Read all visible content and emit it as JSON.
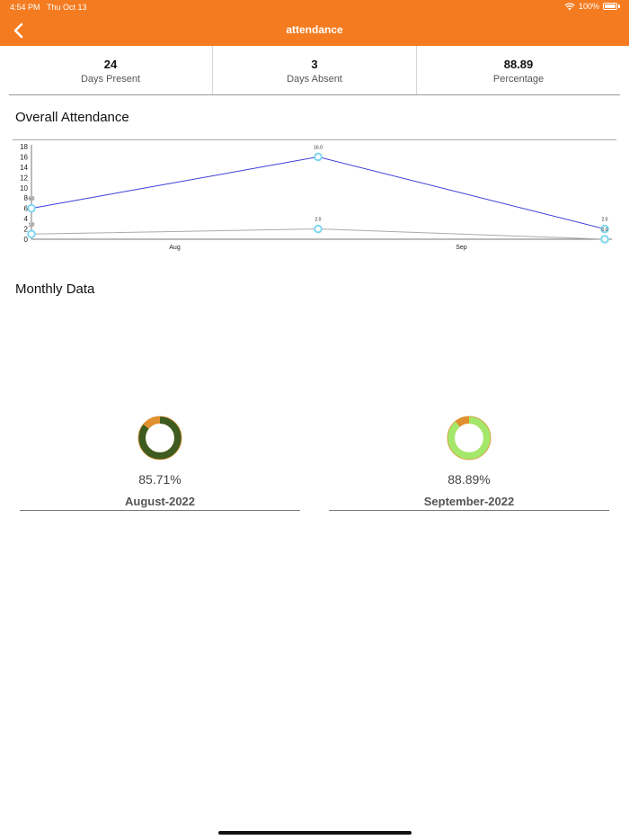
{
  "status_bar": {
    "time": "4:54 PM",
    "date": "Thu Oct 13",
    "battery": "100%"
  },
  "header": {
    "title": "attendance",
    "back_icon": "chevron-left-icon",
    "color": "#f47b20"
  },
  "stats": [
    {
      "value": "24",
      "label": "Days Present"
    },
    {
      "value": "3",
      "label": "Days Absent"
    },
    {
      "value": "88.89",
      "label": "Percentage"
    }
  ],
  "overall": {
    "title": "Overall Attendance"
  },
  "chart_data": {
    "type": "line",
    "x": [
      "",
      "Aug",
      "",
      "Sep",
      ""
    ],
    "y_ticks": [
      "0",
      "2",
      "4",
      "6",
      "8",
      "10",
      "12",
      "14",
      "16",
      "18"
    ],
    "ylim": [
      0,
      18
    ],
    "point_labels": {
      "series1": [
        "6.0",
        "16.0",
        "2.0"
      ],
      "series2": [
        "1.0",
        "2.0",
        "0.0"
      ]
    },
    "series": [
      {
        "values": [
          6,
          16,
          2
        ],
        "color": "#3d3dd8"
      },
      {
        "values": [
          1,
          2,
          0
        ],
        "color": "#aaaaaa"
      }
    ],
    "marker_color": "#7fd7f0"
  },
  "monthly": {
    "title": "Monthly Data",
    "items": [
      {
        "percent": "85.71%",
        "month": "August-2022",
        "value": 85.71,
        "ring_color": "#3d5b1f",
        "bg_color": "#1f3a14"
      },
      {
        "percent": "88.89%",
        "month": "September-2022",
        "value": 88.89,
        "ring_color": "#a3e86b",
        "bg_color": "#a3e86b"
      }
    ]
  }
}
